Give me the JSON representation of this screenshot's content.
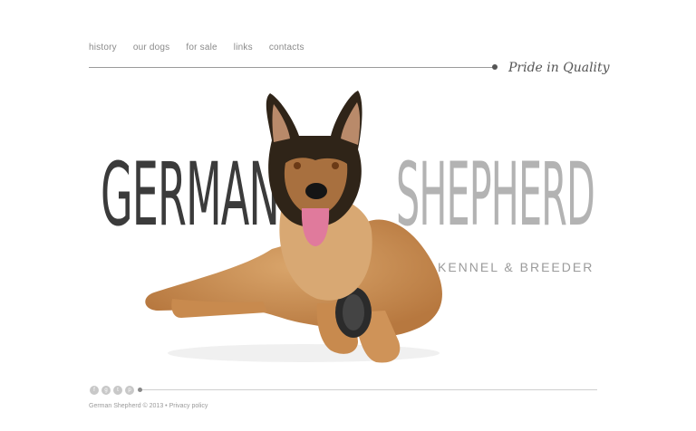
{
  "nav": {
    "items": [
      "history",
      "our dogs",
      "for sale",
      "links",
      "contacts"
    ]
  },
  "tagline": "Pride in Quality",
  "hero": {
    "word1": "GERMAN",
    "word2": "SHEPHERD",
    "subtitle": "KENNEL & BREEDER",
    "image": "german-shepherd-dog-lying"
  },
  "social": [
    "facebook-icon",
    "google-plus-icon",
    "twitter-icon",
    "pinterest-icon"
  ],
  "footer": {
    "copyright": "German Shepherd © 2013",
    "separator": "•",
    "privacy": "Privacy policy"
  },
  "colors": {
    "dark_text": "#3b3b3b",
    "light_text": "#b3b3b3",
    "accent_line": "#9a9a9a"
  }
}
